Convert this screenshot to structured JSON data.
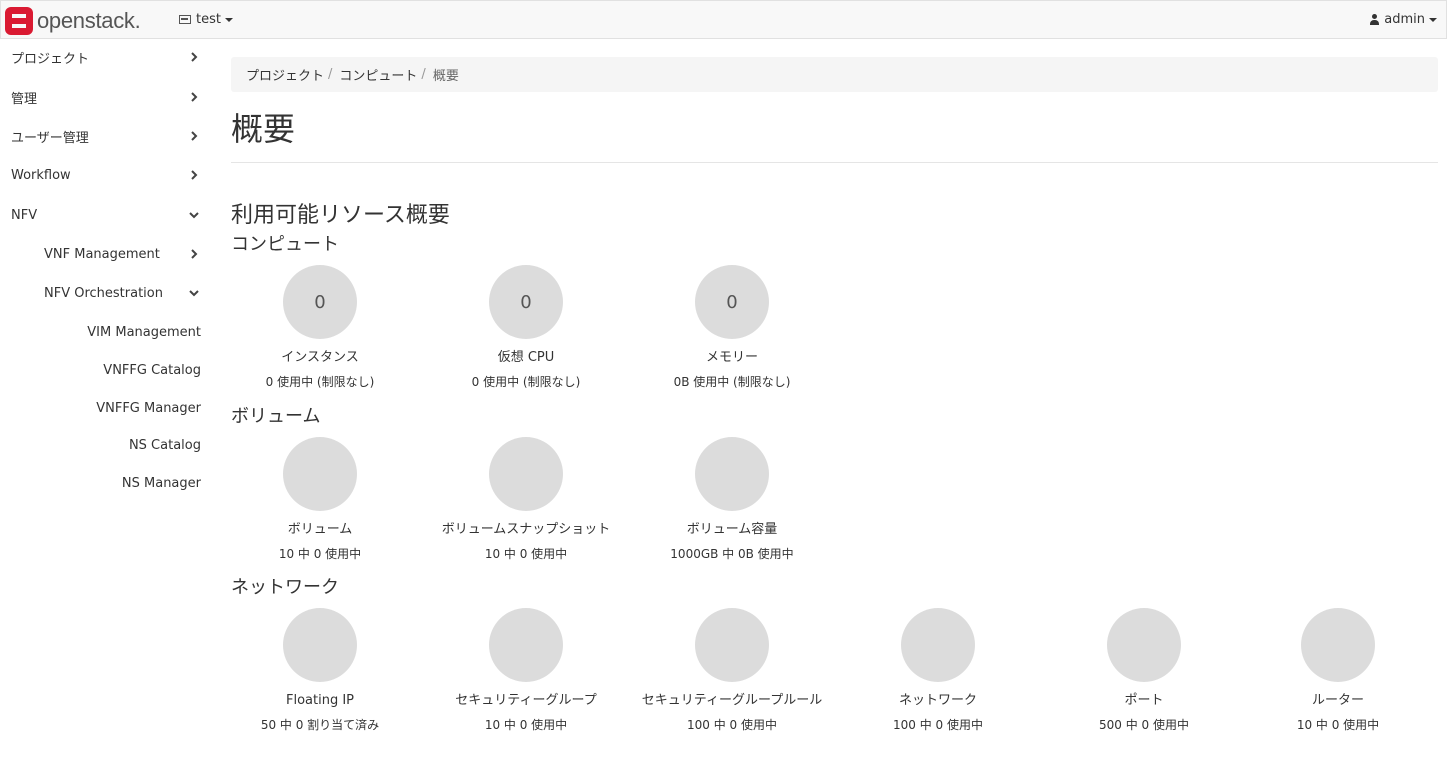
{
  "navbar": {
    "brand": "openstack.",
    "project": "test",
    "user": "admin"
  },
  "sidebar": {
    "items": [
      {
        "label": "プロジェクト",
        "chevron": "right"
      },
      {
        "label": "管理",
        "chevron": "right"
      },
      {
        "label": "ユーザー管理",
        "chevron": "right"
      },
      {
        "label": "Workflow",
        "chevron": "right"
      },
      {
        "label": "NFV",
        "chevron": "down"
      }
    ],
    "nfv_items": [
      {
        "label": "VNF Management",
        "chevron": "right"
      },
      {
        "label": "NFV Orchestration",
        "chevron": "down"
      }
    ],
    "orchestration_items": [
      {
        "label": "VIM Management"
      },
      {
        "label": "VNFFG Catalog"
      },
      {
        "label": "VNFFG Manager"
      },
      {
        "label": "NS Catalog"
      },
      {
        "label": "NS Manager"
      }
    ]
  },
  "breadcrumb": {
    "items": [
      "プロジェクト",
      "コンピュート"
    ],
    "separator": "/",
    "active": "概要"
  },
  "page": {
    "title": "概要",
    "section_title": "利用可能リソース概要"
  },
  "groups": {
    "compute": {
      "title": "コンピュート",
      "pies": [
        {
          "value": "0",
          "label": "インスタンス",
          "usage": "0 使用中 (制限なし)"
        },
        {
          "value": "0",
          "label": "仮想 CPU",
          "usage": "0 使用中 (制限なし)"
        },
        {
          "value": "0",
          "label": "メモリー",
          "usage": "0B 使用中 (制限なし)"
        }
      ]
    },
    "volume": {
      "title": "ボリューム",
      "pies": [
        {
          "value": "",
          "label": "ボリューム",
          "usage": "10 中 0 使用中"
        },
        {
          "value": "",
          "label": "ボリュームスナップショット",
          "usage": "10 中 0 使用中"
        },
        {
          "value": "",
          "label": "ボリューム容量",
          "usage": "1000GB 中 0B 使用中"
        }
      ]
    },
    "network": {
      "title": "ネットワーク",
      "pies": [
        {
          "value": "",
          "label": "Floating IP",
          "usage": "50 中 0 割り当て済み"
        },
        {
          "value": "",
          "label": "セキュリティーグループ",
          "usage": "10 中 0 使用中"
        },
        {
          "value": "",
          "label": "セキュリティーグループルール",
          "usage": "100 中 0 使用中"
        },
        {
          "value": "",
          "label": "ネットワーク",
          "usage": "100 中 0 使用中"
        },
        {
          "value": "",
          "label": "ポート",
          "usage": "500 中 0 使用中"
        },
        {
          "value": "",
          "label": "ルーター",
          "usage": "10 中 0 使用中"
        }
      ]
    }
  },
  "colors": {
    "brand": "#da1a32",
    "pie_fill": "#dcdcdc"
  }
}
